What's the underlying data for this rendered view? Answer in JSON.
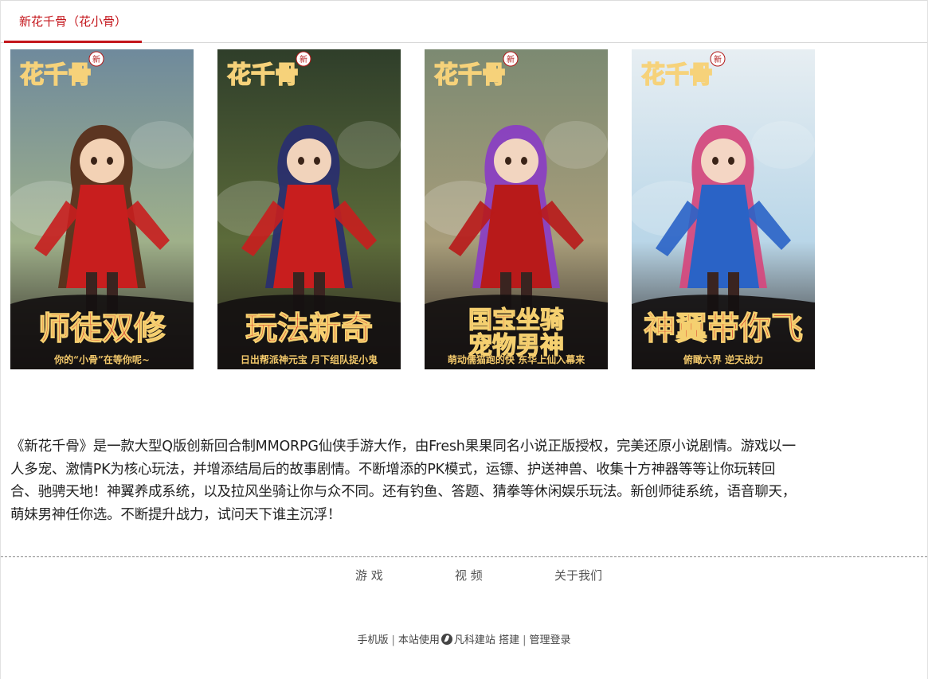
{
  "tabs": {
    "active_label": "新花千骨（花小骨）"
  },
  "gallery": [
    {
      "logo_text": "花千骨",
      "new_badge": "新",
      "banner_text": "师徒双修",
      "caption": "你的“小骨”在等你呢~",
      "bg_top": "#6f8a9c",
      "bg_mid": "#9fb08a",
      "accent": "#c81e1e",
      "skin": "#f3d2b5",
      "hair": "#5a2f1a"
    },
    {
      "logo_text": "花千骨",
      "new_badge": "新",
      "banner_text": "玩法新奇",
      "caption": "日出帮派神元宝 月下组队捉小鬼",
      "bg_top": "#2f3e2a",
      "bg_mid": "#5c6b3a",
      "accent": "#c81e1e",
      "skin": "#f1d3bb",
      "hair": "#2a2f6e"
    },
    {
      "logo_text": "花千骨",
      "new_badge": "新",
      "banner_text": "国宝坐骑 宠物男神",
      "caption": "萌动儒猫跑的快 东华上仙入幕来",
      "bg_top": "#7c8a72",
      "bg_mid": "#a89d7a",
      "accent": "#b81a1a",
      "skin": "#f2d5c0",
      "hair": "#8a3fc2"
    },
    {
      "logo_text": "花千骨",
      "new_badge": "新",
      "banner_text": "神翼带你飞",
      "caption": "俯瞰六界 逆天战力",
      "bg_top": "#e7eef2",
      "bg_mid": "#b9d6e8",
      "accent": "#2a63c6",
      "skin": "#f4d6c4",
      "hair": "#d44a7e"
    }
  ],
  "description": "《新花千骨》是一款大型Q版创新回合制MMORPG仙侠手游大作，由Fresh果果同名小说正版授权，完美还原小说剧情。游戏以一人多宠、激情PK为核心玩法，并增添结局后的故事剧情。不断增添的PK模式，运镖、护送神兽、收集十方神器等等让你玩转回合、驰骋天地！神翼养成系统，以及拉风坐骑让你与众不同。还有钓鱼、答题、猜拳等休闲娱乐玩法。新创师徒系统，语音聊天，萌妹男神任你选。不断提升战力，试问天下谁主沉浮！",
  "footer_nav": {
    "games": "游 戏",
    "videos": "视 频",
    "about": "关于我们"
  },
  "bottom": {
    "mobile": "手机版",
    "powered_prefix": "本站使用",
    "brand": "凡科建站",
    "powered_suffix": "搭建",
    "admin": "管理登录",
    "sep": "|"
  },
  "colors": {
    "accent_red": "#c4161c"
  }
}
